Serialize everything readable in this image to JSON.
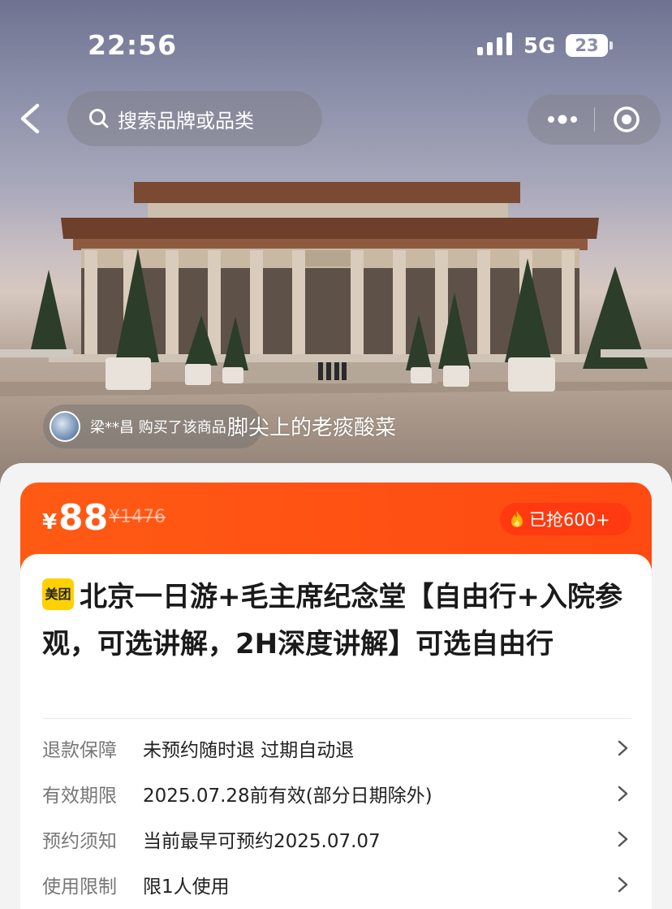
{
  "status_bar": {
    "time": "22:56",
    "network": "5G",
    "battery": "23"
  },
  "nav": {
    "search_placeholder": "搜索品牌或品类"
  },
  "hero": {
    "buyer_notice": "梁**昌 购买了该商品",
    "watermark": "脚尖上的老痰酸菜"
  },
  "price": {
    "currency": "¥",
    "current": "88",
    "original": "¥1476",
    "sold": "已抢600+"
  },
  "product": {
    "brand": "美团",
    "title": "北京一日游+毛主席纪念堂【自由行+入院参观，可选讲解，2H深度讲解】可选自由行"
  },
  "details": [
    {
      "key": "退款保障",
      "value": "未预约随时退 过期自动退"
    },
    {
      "key": "有效期限",
      "value": "2025.07.28前有效(部分日期除外)"
    },
    {
      "key": "预约须知",
      "value": "当前最早可预约2025.07.07"
    },
    {
      "key": "使用限制",
      "value": "限1人使用"
    }
  ],
  "colors": {
    "accent": "#ff4a12",
    "brand_badge": "#ffd100"
  }
}
